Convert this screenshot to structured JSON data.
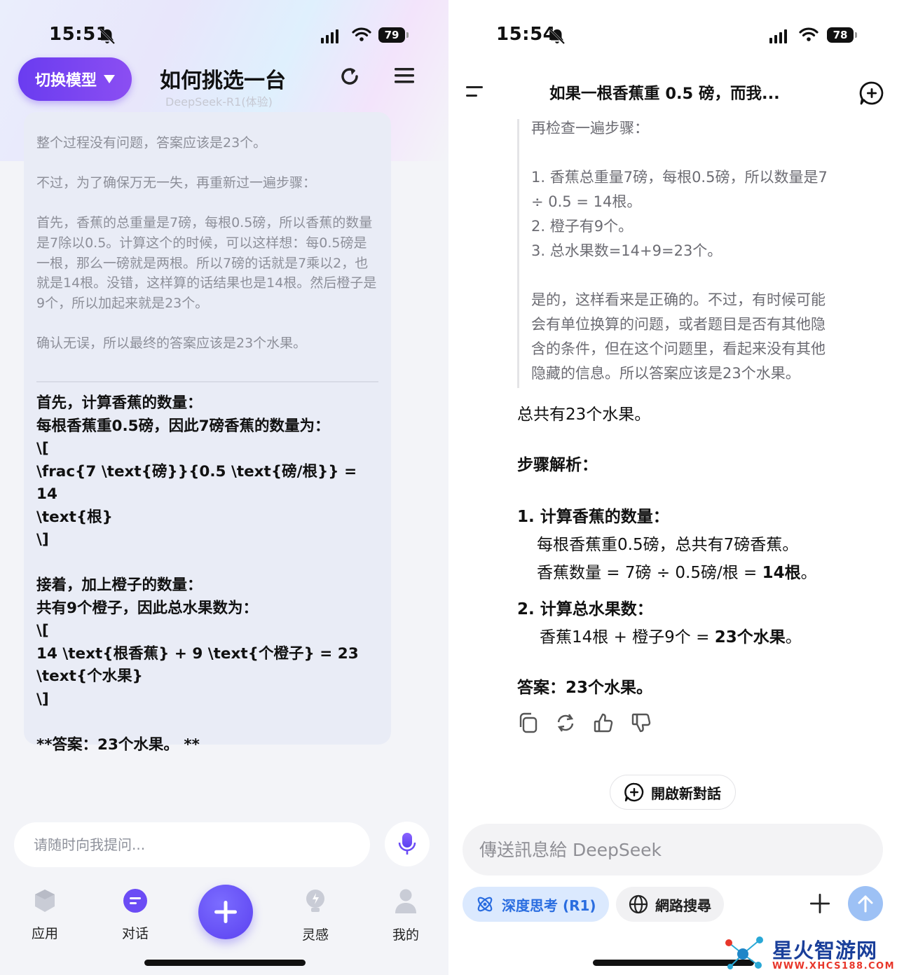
{
  "left": {
    "status": {
      "time": "15:51",
      "battery": "79"
    },
    "switch_model_label": "切换模型",
    "title": "如何挑选一台",
    "subtitle": "DeepSeek-R1(体验)",
    "thinking": [
      "整个过程没有问题，答案应该是23个。",
      "不过，为了确保万无一失，再重新过一遍步骤：",
      "首先，香蕉的总重量是7磅，每根0.5磅，所以香蕉的数量是7除以0.5。计算这个的时候，可以这样想：每0.5磅是一根，那么一磅就是两根。所以7磅的话就是7乘以2，也就是14根。没错，这样算的话结果也是14根。然后橙子是9个，所以加起来就是23个。",
      "确认无误，所以最终的答案应该是23个水果。"
    ],
    "answer_lines": [
      "首先，计算香蕉的数量：",
      "每根香蕉重0.5磅，因此7磅香蕉的数量为：",
      "\\[",
      "\\frac{7 \\text{磅}}{0.5 \\text{磅/根}} = 14",
      "\\text{根}",
      "\\]",
      "",
      "接着，加上橙子的数量：",
      "共有9个橙子，因此总水果数为：",
      "\\[",
      "14 \\text{根香蕉} + 9 \\text{个橙子} = 23",
      "\\text{个水果}",
      "\\]",
      "",
      "**答案：23个水果。 **"
    ],
    "input_placeholder": "请随时向我提问...",
    "tabs": [
      {
        "label": "应用",
        "icon": "cube-icon"
      },
      {
        "label": "对话",
        "icon": "chat-bubble-icon"
      },
      {
        "label": "灵感",
        "icon": "bulb-icon"
      },
      {
        "label": "我的",
        "icon": "person-icon"
      }
    ],
    "accent": "#6a3cf0"
  },
  "right": {
    "status": {
      "time": "15:54",
      "battery": "78"
    },
    "title": "如果一根香蕉重 0.5 磅，而我...",
    "thinking_lines": [
      "再检查一遍步骤：",
      "",
      "1. 香蕉总重量7磅，每根0.5磅，所以数量是7",
      "÷ 0.5 = 14根。",
      "2. 橙子有9个。",
      "3. 总水果数=14+9=23个。",
      "",
      "是的，这样看来是正确的。不过，有时候可能",
      "会有单位换算的问题，或者题目是否有其他隐",
      "含的条件，但在这个问题里，看起来没有其他",
      "隐藏的信息。所以答案应该是23个水果。"
    ],
    "answer": {
      "total": "总共有23个水果。",
      "steps_heading": "步骤解析：",
      "step1_title": "1. 计算香蕉的数量：",
      "step1_line1": "每根香蕉重0.5磅，总共有7磅香蕉。",
      "step1_line2_prefix": "香蕉数量 = 7磅 ÷ 0.5磅/根 = ",
      "step1_line2_bold": "14根",
      "step1_line2_suffix": "。",
      "step2_title": "2. 计算总水果数：",
      "step2_line_prefix": "香蕉14根 + 橙子9个 = ",
      "step2_line_bold": "23个水果",
      "step2_line_suffix": "。",
      "final_label": "答案：",
      "final_value": "23个水果",
      "final_suffix": "。"
    },
    "new_chat_label": "開啟新對話",
    "input_placeholder": "傳送訊息給 DeepSeek",
    "deep_think_label": "深度思考 (R1)",
    "web_search_label": "網路搜尋",
    "accent": "#2a6de0"
  },
  "watermark": {
    "name": "星火智游网",
    "url": "WWW.XHCS188.COM"
  }
}
